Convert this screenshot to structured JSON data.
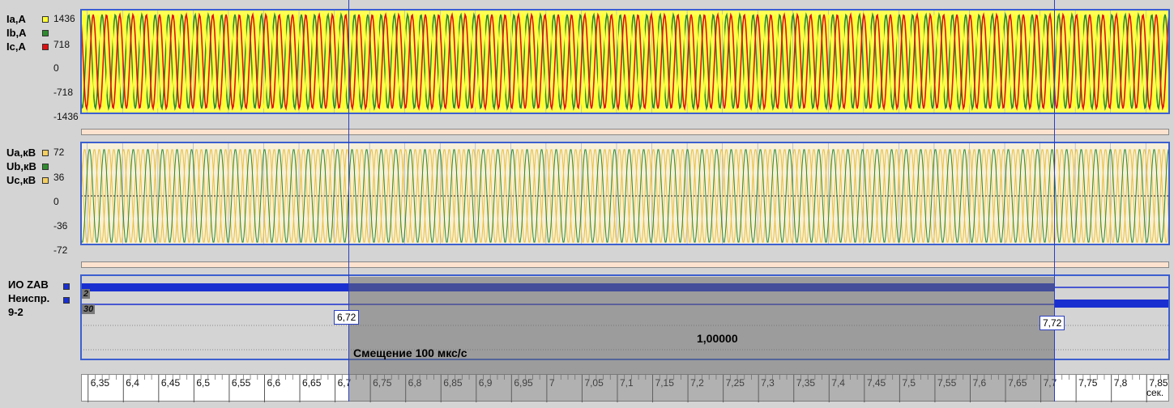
{
  "current_panel": {
    "legend": [
      {
        "label": "Ia,A",
        "color": "#ffff33"
      },
      {
        "label": "Ib,A",
        "color": "#2e8b2e"
      },
      {
        "label": "Ic,A",
        "color": "#e01010"
      }
    ],
    "ticks": [
      "1436",
      "718",
      "0",
      "-718",
      "-1436"
    ]
  },
  "voltage_panel": {
    "legend": [
      {
        "label": "Ua,кВ",
        "color": "#f5d060"
      },
      {
        "label": "Ub,кВ",
        "color": "#2e8b2e"
      },
      {
        "label": "Uc,кВ",
        "color": "#f5d060"
      }
    ],
    "ticks": [
      "72",
      "36",
      "0",
      "-36",
      "-72"
    ]
  },
  "digital_panel": {
    "legend": [
      {
        "label": "ИО ZAB",
        "color": "#1a2fd0"
      },
      {
        "label": "Неиспр.",
        "color": "#1a2fd0"
      },
      {
        "label": "9-2",
        "color": null
      }
    ],
    "badges": [
      "2",
      "30"
    ]
  },
  "cursors": {
    "left_value": "6,72",
    "right_value": "7,72",
    "delta": "1,00000",
    "offset_text": "Смещение 100 мкс/с"
  },
  "time_axis": {
    "ticks": [
      "6,35",
      "6,4",
      "6,45",
      "6,5",
      "6,55",
      "6,6",
      "6,65",
      "6,7",
      "6,75",
      "6,8",
      "6,85",
      "6,9",
      "6,95",
      "7",
      "7,05",
      "7,1",
      "7,15",
      "7,2",
      "7,25",
      "7,3",
      "7,35",
      "7,4",
      "7,45",
      "7,5",
      "7,55",
      "7,6",
      "7,65",
      "7,7",
      "7,75",
      "7,8",
      "7,85"
    ],
    "unit": "сек."
  }
}
